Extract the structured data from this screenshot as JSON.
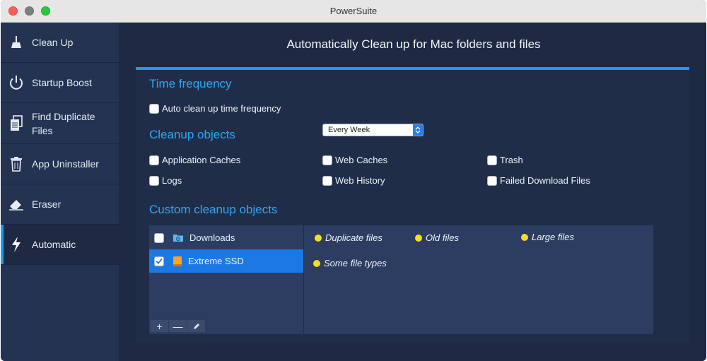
{
  "window": {
    "title": "PowerSuite"
  },
  "sidebar": {
    "items": [
      {
        "label": "Clean Up",
        "icon": "broom-icon"
      },
      {
        "label": "Startup Boost",
        "icon": "power-icon"
      },
      {
        "label": "Find Duplicate Files",
        "icon": "duplicate-files-icon"
      },
      {
        "label": "App Uninstaller",
        "icon": "trash-icon"
      },
      {
        "label": "Eraser",
        "icon": "eraser-icon"
      },
      {
        "label": "Automatic",
        "icon": "lightning-icon",
        "active": true
      }
    ]
  },
  "main": {
    "header": "Automatically Clean up for Mac folders and files",
    "time_frequency": {
      "title": "Time frequency",
      "checkbox_label": "Auto clean up time frequency",
      "checked": false,
      "select_value": "Every Week"
    },
    "cleanup_objects": {
      "title": "Cleanup objects",
      "items": [
        {
          "label": "Application Caches",
          "checked": false
        },
        {
          "label": "Web Caches",
          "checked": false
        },
        {
          "label": "Trash",
          "checked": false
        },
        {
          "label": "Logs",
          "checked": false
        },
        {
          "label": "Web History",
          "checked": false
        },
        {
          "label": "Failed Download Files",
          "checked": false
        }
      ]
    },
    "custom_objects": {
      "title": "Custom cleanup objects",
      "folders": [
        {
          "label": "Downloads",
          "checked": false,
          "icon": "folder-icon"
        },
        {
          "label": "Extreme SSD",
          "checked": true,
          "selected": true,
          "icon": "drive-icon"
        }
      ],
      "toolbar": {
        "add": "+",
        "remove": "—"
      },
      "tags": [
        "Duplicate files",
        "Old files",
        "Large files",
        "Some file types"
      ]
    }
  },
  "colors": {
    "accent": "#1c9bf0",
    "background": "#1e2a44",
    "sidebar": "#243352",
    "tag_dot": "#f5de23"
  }
}
